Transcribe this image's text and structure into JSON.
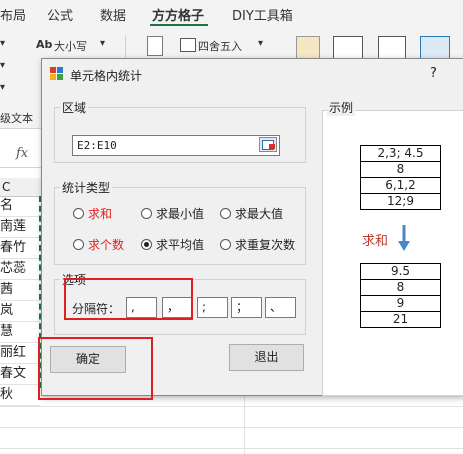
{
  "ribbon": {
    "tabs": [
      "布局",
      "公式",
      "数据",
      "方方格子",
      "DIY工具箱"
    ],
    "active_tab": "方方格子",
    "font_size_btn": "大小写",
    "round_btn": "四舍五入",
    "advanced_text": "级文本"
  },
  "formula_bar": {
    "fx": "fx"
  },
  "sheet": {
    "col_header": "C",
    "cells": [
      "名",
      "南莲",
      "春竹",
      "芯蕊",
      "茜",
      "岚",
      "慧",
      "丽红",
      "春文",
      "秋"
    ]
  },
  "dialog": {
    "title": "单元格内统计",
    "help": "?",
    "range_group": "区域",
    "range_value": "E2:E10",
    "type_group": "统计类型",
    "options": [
      {
        "label": "求和",
        "selected": false,
        "red": true
      },
      {
        "label": "求最小值",
        "selected": false,
        "red": false
      },
      {
        "label": "求最大值",
        "selected": false,
        "red": false
      },
      {
        "label": "求个数",
        "selected": false,
        "red": true
      },
      {
        "label": "求平均值",
        "selected": true,
        "red": false
      },
      {
        "label": "求重复次数",
        "selected": false,
        "red": false
      }
    ],
    "sep_group": "选项",
    "sep_label": "分隔符：",
    "separators": [
      ",",
      "，",
      ";",
      "；",
      "、"
    ],
    "ok": "确定",
    "exit": "退出"
  },
  "example": {
    "label": "示例",
    "input": [
      "2,3; 4.5",
      "8",
      "6,1,2",
      "12;9"
    ],
    "op": "求和",
    "output": [
      "9.5",
      "8",
      "9",
      "21"
    ]
  },
  "colors": {
    "accent": "#217346",
    "red": "#e02020",
    "arrow": "#4a86c8"
  }
}
